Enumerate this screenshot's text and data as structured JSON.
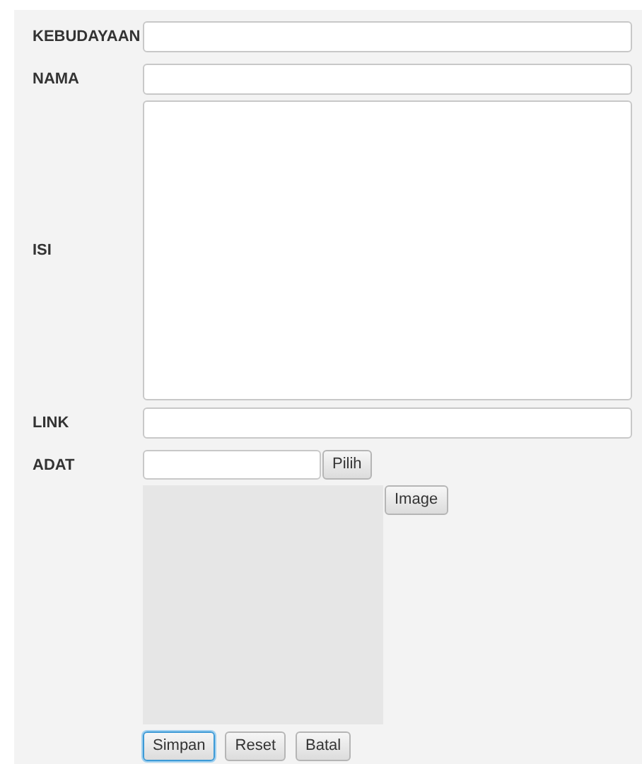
{
  "form": {
    "fields": [
      {
        "label": "KEBUDAYAAN",
        "kind": "text"
      },
      {
        "label": "NAMA",
        "kind": "text"
      },
      {
        "label": "ISI",
        "kind": "textarea"
      },
      {
        "label": "LINK",
        "kind": "text"
      },
      {
        "label": "ADAT",
        "kind": "file",
        "button": "Pilih"
      }
    ],
    "image_button": "Image",
    "actions": [
      {
        "label": "Simpan",
        "focused": true
      },
      {
        "label": "Reset",
        "focused": false
      },
      {
        "label": "Batal",
        "focused": false
      }
    ]
  }
}
